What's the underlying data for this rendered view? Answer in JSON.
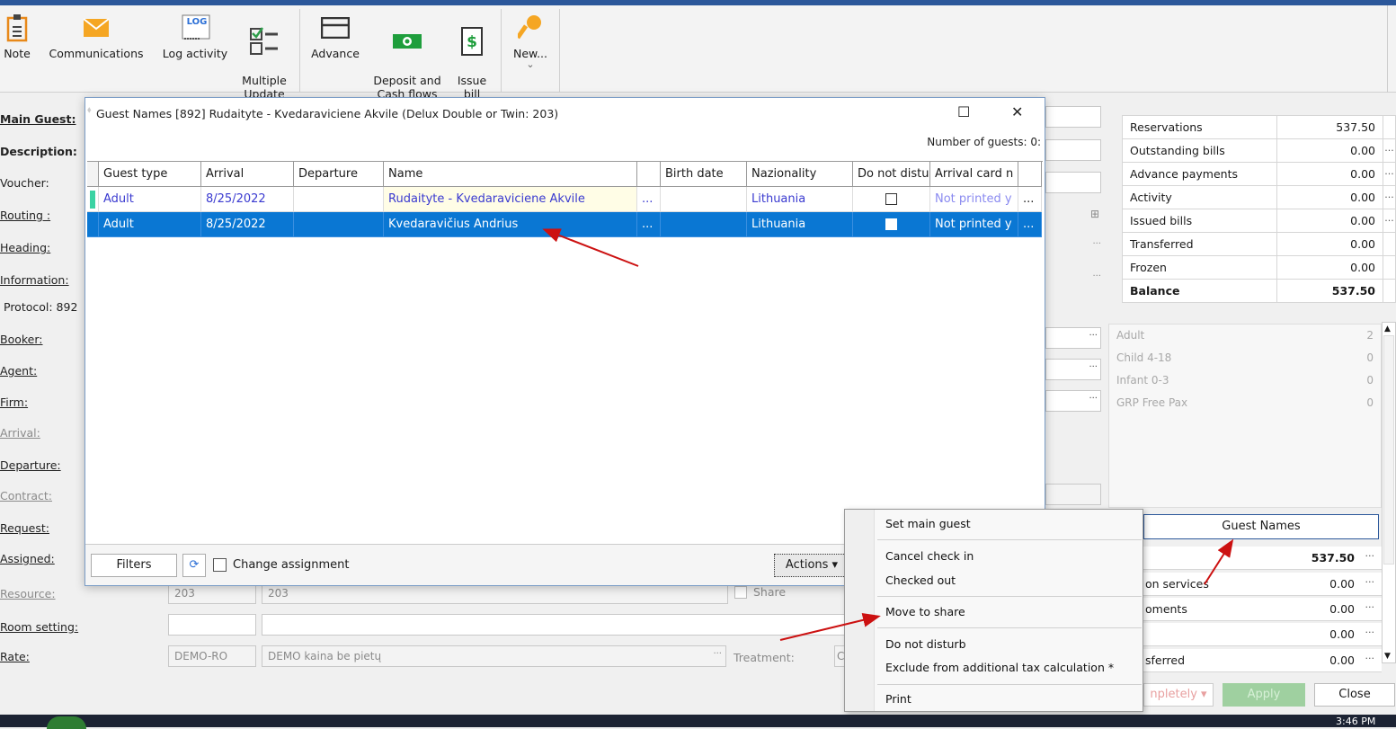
{
  "ribbon": {
    "buttons": [
      {
        "label": "Note",
        "icon": "note-icon"
      },
      {
        "label": "Communications",
        "icon": "envelope-icon"
      },
      {
        "label": "Log activity",
        "icon": "log-icon"
      },
      {
        "label": "Multiple\nUpdate",
        "icon": "checklist-icon"
      },
      {
        "label": "Advance",
        "icon": "card-icon"
      },
      {
        "label": "Deposit and\nCash flows",
        "icon": "cash-icon"
      },
      {
        "label": "Issue\nbill",
        "icon": "dollar-bill-icon"
      },
      {
        "label": "New...",
        "icon": "key-icon"
      }
    ],
    "log_badge": "LOG",
    "new_chevron": "⌄"
  },
  "left_labels": [
    "Main Guest:",
    "Description:",
    "Voucher:",
    "Routing :",
    "Heading:",
    "Information:",
    "Protocol: 892",
    "Booker:",
    "Agent:",
    "Firm:",
    "Arrival:",
    "Departure:",
    "Contract:",
    "Request:",
    "Assigned:",
    "Resource:",
    "Room setting:",
    "Rate:"
  ],
  "bottom_fields": {
    "resource_code": "203",
    "resource_name": "203",
    "share_label": "Share",
    "rate_code": "DEMO-RO",
    "rate_name": "DEMO kaina be pietų",
    "treatment_label": "Treatment:",
    "treatment_value": "C"
  },
  "summary": [
    {
      "label": "Reservations",
      "value": "537.50",
      "dots": ""
    },
    {
      "label": "Outstanding bills",
      "value": "0.00",
      "dots": "···"
    },
    {
      "label": "Advance payments",
      "value": "0.00",
      "dots": "···"
    },
    {
      "label": "Activity",
      "value": "0.00",
      "dots": "···"
    },
    {
      "label": "Issued bills",
      "value": "0.00",
      "dots": "···"
    },
    {
      "label": "Transferred",
      "value": "0.00",
      "dots": ""
    },
    {
      "label": "Frozen",
      "value": "0.00",
      "dots": ""
    },
    {
      "label": "Balance",
      "value": "537.50",
      "dots": ""
    }
  ],
  "guest_counts": [
    {
      "label": "Adult",
      "value": "2"
    },
    {
      "label": "Child 4-18",
      "value": "0"
    },
    {
      "label": "Infant 0-3",
      "value": "0"
    },
    {
      "label": "GRP Free Pax",
      "value": "0"
    }
  ],
  "guest_names_button": "Guest Names",
  "finance_rows": [
    {
      "label": "",
      "value": "537.50"
    },
    {
      "label": "on services",
      "value": "0.00"
    },
    {
      "label": "oments",
      "value": "0.00"
    },
    {
      "label": "",
      "value": "0.00"
    },
    {
      "label": "sferred",
      "value": "0.00"
    }
  ],
  "bottom_buttons": {
    "completely": "npletely ▾",
    "apply": "Apply",
    "close": "Close"
  },
  "clock": "3:46 PM",
  "dialog": {
    "title": "Guest Names [892] Rudaityte - Kvedaraviciene Akvile (Delux Double or Twin: 203)",
    "num_guests": "Number of guests: 0:",
    "columns": [
      "Guest type",
      "Arrival",
      "Departure",
      "Name",
      "",
      "Birth date",
      "Nazionality",
      "Do not distu",
      "Arrival card n"
    ],
    "rows": [
      {
        "guest_type": "Adult",
        "arrival": "8/25/2022",
        "departure": "",
        "name": "Rudaityte - Kvedaraviciene Akvile",
        "birth": "",
        "nationality": "Lithuania",
        "card": "Not printed y"
      },
      {
        "guest_type": "Adult",
        "arrival": "8/25/2022",
        "departure": "",
        "name": "Kvedaravičius Andrius",
        "birth": "",
        "nationality": "Lithuania",
        "card": "Not printed y"
      }
    ],
    "ellipsis": "...",
    "filters": "Filters",
    "change_assignment": "Change assignment",
    "actions": "Actions ▾"
  },
  "menu": {
    "items": [
      "Set main guest",
      "Cancel check in",
      "Checked out",
      "Move to share",
      "Do not disturb",
      "Exclude from additional tax calculation *",
      "Print"
    ]
  },
  "colors": {
    "selection": "#0a77d3",
    "link_text": "#3a3ad0",
    "annotation_arrow": "#cc1111"
  }
}
